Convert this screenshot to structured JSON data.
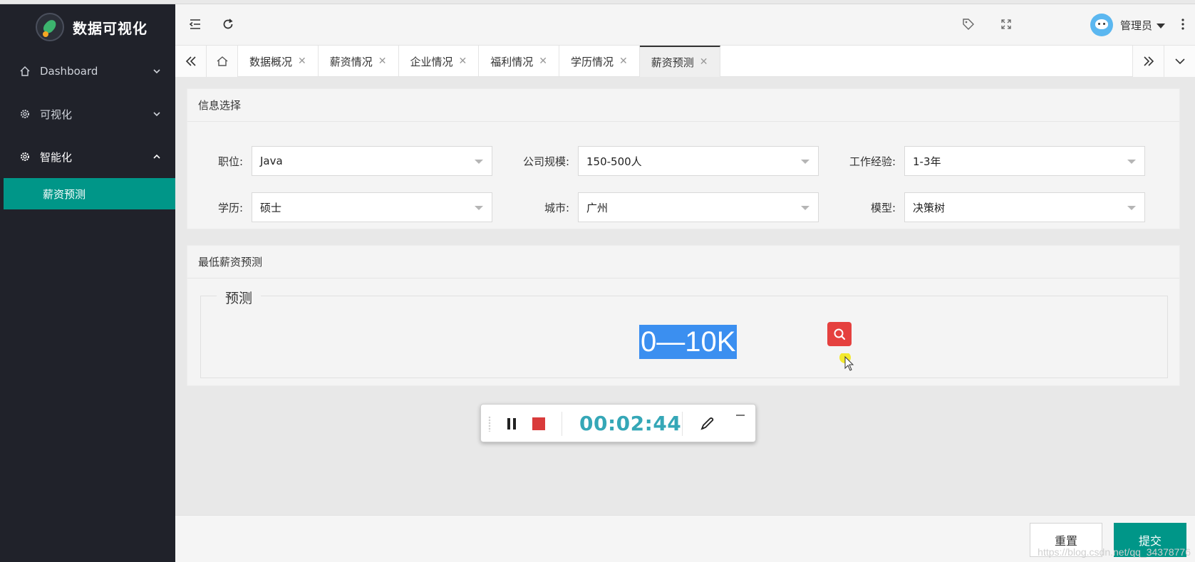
{
  "brand": {
    "title": "数据可视化"
  },
  "sidebar": {
    "items": [
      {
        "label": "Dashboard",
        "icon": "home-icon"
      },
      {
        "label": "可视化",
        "icon": "gear-icon"
      },
      {
        "label": "智能化",
        "icon": "gear-icon"
      }
    ],
    "submenu": [
      {
        "label": "薪资预测"
      }
    ]
  },
  "header": {
    "user_name": "管理员"
  },
  "tabs": [
    {
      "label": "数据概况"
    },
    {
      "label": "薪资情况"
    },
    {
      "label": "企业情况"
    },
    {
      "label": "福利情况"
    },
    {
      "label": "学历情况"
    },
    {
      "label": "薪资预测"
    }
  ],
  "info_card": {
    "title": "信息选择",
    "fields": [
      {
        "label": "职位:",
        "value": "Java"
      },
      {
        "label": "公司规模:",
        "value": "150-500人"
      },
      {
        "label": "工作经验:",
        "value": "1-3年"
      },
      {
        "label": "学历:",
        "value": "硕士"
      },
      {
        "label": "城市:",
        "value": "广州"
      },
      {
        "label": "模型:",
        "value": "决策树"
      }
    ]
  },
  "predict_card": {
    "title": "最低薪资预测",
    "legend": "预测",
    "result": "0—10K"
  },
  "recorder": {
    "time": "00:02:44"
  },
  "footer": {
    "reset_label": "重置",
    "submit_label": "提交"
  },
  "watermark": "https://blog.csdn.net/qq_34378776",
  "colors": {
    "accent": "#009688",
    "sidebar": "#20222a",
    "highlight": "#3b8ff0",
    "timer": "#35a7b7"
  }
}
